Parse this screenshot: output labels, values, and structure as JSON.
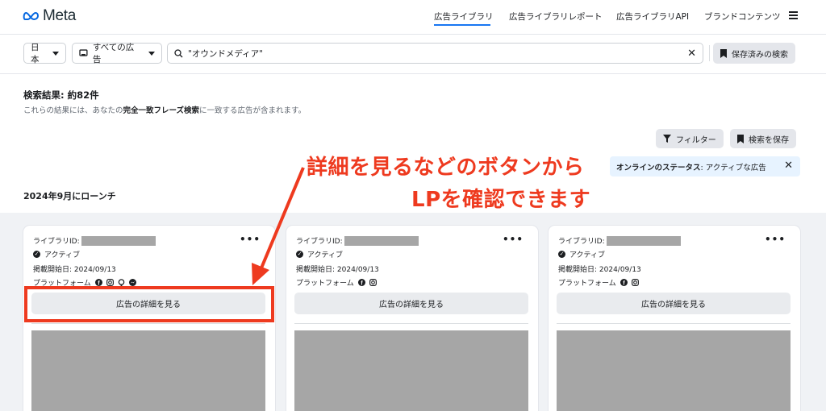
{
  "header": {
    "logo_text": "Meta",
    "nav": [
      {
        "label": "広告ライブラリ",
        "active": true
      },
      {
        "label": "広告ライブラリレポート",
        "active": false
      },
      {
        "label": "広告ライブラリAPI",
        "active": false
      },
      {
        "label": "ブランドコンテンツ",
        "active": false
      }
    ]
  },
  "toolbar": {
    "country": "日本",
    "category": "すべての広告",
    "search_value": "\"オウンドメディア\"",
    "saved_search_label": "保存済みの検索"
  },
  "results": {
    "title": "検索結果: 約82件",
    "desc_prefix": "これらの結果には、あなたの",
    "desc_bold": "完全一致フレーズ検索",
    "desc_suffix": "に一致する広告が含まれます。",
    "filter_label": "フィルター",
    "save_search_label": "検索を保存",
    "status_label": "オンラインのステータス",
    "status_value": ": アクティブな広告",
    "launch_label": "2024年9月にローンチ"
  },
  "annotation": {
    "line1": "詳細を見るなどのボタンから",
    "line2": "LPを確認できます",
    "color": "#ee3a1f"
  },
  "cards": [
    {
      "library_id_label": "ライブラリID:",
      "status": "アクティブ",
      "start_date": "掲載開始日: 2024/09/13",
      "platform_label": "プラットフォーム",
      "platforms": [
        "facebook-icon",
        "instagram-icon",
        "audience-network-icon",
        "messenger-icon"
      ],
      "detail_label": "広告の詳細を見る"
    },
    {
      "library_id_label": "ライブラリID:",
      "status": "アクティブ",
      "start_date": "掲載開始日: 2024/09/13",
      "platform_label": "プラットフォーム",
      "platforms": [
        "facebook-icon",
        "instagram-icon"
      ],
      "detail_label": "広告の詳細を見る"
    },
    {
      "library_id_label": "ライブラリID:",
      "status": "アクティブ",
      "start_date": "掲載開始日: 2024/09/13",
      "platform_label": "プラットフォーム",
      "platforms": [
        "facebook-icon",
        "instagram-icon"
      ],
      "detail_label": "広告の詳細を見る"
    }
  ],
  "colors": {
    "accent": "#1877f2",
    "highlight": "#ee3a1f"
  }
}
